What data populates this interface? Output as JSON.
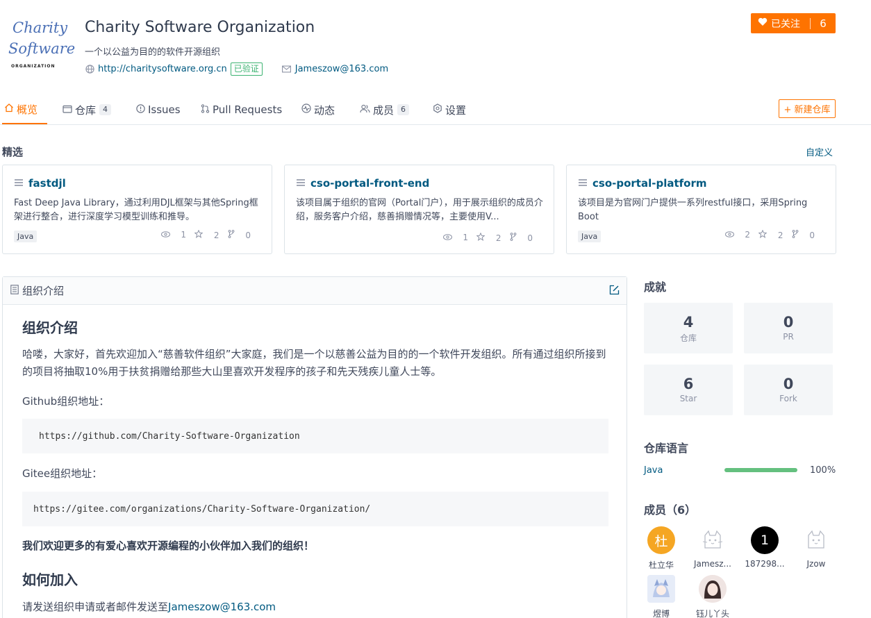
{
  "org": {
    "logo_line1": "Charity",
    "logo_line2": "Software",
    "logo_line3": "ORGANIZATION",
    "name": "Charity Software Organization",
    "description": "一个以公益为目的的软件开源组织",
    "website": "http://charitysoftware.org.cn",
    "verified_label": "已验证",
    "email": "Jameszow@163.com",
    "follow_label": "已关注",
    "follow_count": "6"
  },
  "tabs": [
    {
      "label": "概览",
      "icon": "home-icon"
    },
    {
      "label": "仓库",
      "badge": "4",
      "icon": "repo-icon"
    },
    {
      "label": "Issues",
      "icon": "issue-icon"
    },
    {
      "label": "Pull Requests",
      "icon": "pull-request-icon"
    },
    {
      "label": "动态",
      "icon": "activity-icon"
    },
    {
      "label": "成员",
      "badge": "6",
      "icon": "members-icon"
    },
    {
      "label": "设置",
      "icon": "settings-icon"
    }
  ],
  "new_repo_label": "+ 新建仓库",
  "featured": {
    "title": "精选",
    "customize_label": "自定义",
    "cards": [
      {
        "name": "fastdjl",
        "description": "Fast Deep Java Library，通过利用DJL框架与其他Spring框架进行整合，进行深度学习模型训练和推导。",
        "language": "Java",
        "watch": "1",
        "star": "2",
        "fork": "0"
      },
      {
        "name": "cso-portal-front-end",
        "description": "该项目属于组织的官网（Portal门户），用于展示组织的成员介绍，服务客户介绍，慈善捐赠情况等，主要使用V...",
        "language": "",
        "watch": "1",
        "star": "2",
        "fork": "0"
      },
      {
        "name": "cso-portal-platform",
        "description": "该项目是为官网门户提供一系列restful接口，采用Spring Boot",
        "language": "Java",
        "watch": "2",
        "star": "2",
        "fork": "0"
      }
    ]
  },
  "readme": {
    "panel_title": "组织介绍",
    "heading": "组织介绍",
    "intro": "哈喽，大家好，首先欢迎加入“慈善软件组织”大家庭，我们是一个以慈善公益为目的的一个软件开发组织。所有通过组织所接到的项目将抽取10%用于扶贫捐赠给那些大山里喜欢开发程序的孩子和先天残疾儿童人士等。",
    "github_label": "Github组织地址：",
    "github_url": "https://github.com/Charity-Software-Organization",
    "gitee_label": "Gitee组织地址：",
    "gitee_url": "https://gitee.com/organizations/Charity-Software-Organization/",
    "welcome": "我们欢迎更多的有爱心喜欢开源编程的小伙伴加入我们的组织！",
    "join_heading": "如何加入",
    "join_text": "请发送组织申请或者邮件发送至",
    "join_email": "Jameszow@163.com"
  },
  "achievements": {
    "title": "成就",
    "items": [
      {
        "value": "4",
        "label": "仓库"
      },
      {
        "value": "0",
        "label": "PR"
      },
      {
        "value": "6",
        "label": "Star"
      },
      {
        "value": "0",
        "label": "Fork"
      }
    ]
  },
  "languages": {
    "title": "仓库语言",
    "items": [
      {
        "name": "Java",
        "percent": "100%",
        "fraction": 1.0
      }
    ]
  },
  "members": {
    "title": "成员（6）",
    "items": [
      {
        "name": "杜立华",
        "avatar_text": "杜",
        "avatar_color": "#f5a623"
      },
      {
        "name": "Jamesz...",
        "avatar_text": "cat",
        "avatar_color": "#ffffff"
      },
      {
        "name": "187298...",
        "avatar_text": "1",
        "avatar_color": "#000000"
      },
      {
        "name": "Jzow",
        "avatar_text": "cat",
        "avatar_color": "#ffffff"
      },
      {
        "name": "煜博",
        "avatar_text": "img",
        "avatar_color": "#b9c9ea"
      },
      {
        "name": "钰儿丫头",
        "avatar_text": "img",
        "avatar_color": "#d8c3c3"
      }
    ]
  },
  "colors": {
    "accent": "#fe7300",
    "link": "#005980",
    "language_bar": "#64c07f",
    "verified": "#3cb371"
  }
}
